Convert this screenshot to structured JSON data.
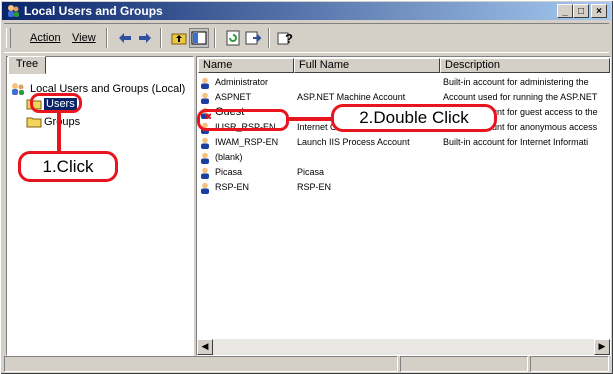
{
  "window": {
    "title": "Local Users and Groups",
    "controls": [
      "_",
      "□",
      "×"
    ]
  },
  "menu": {
    "action": "Action",
    "view": "View"
  },
  "tree": {
    "tab_label": "Tree",
    "root": "Local Users and Groups (Local)",
    "items": [
      "Users",
      "Groups"
    ]
  },
  "list": {
    "columns": [
      "Name",
      "Full Name",
      "Description"
    ],
    "rows": [
      {
        "name": "Administrator",
        "full_name": "",
        "description": "Built-in account for administering the"
      },
      {
        "name": "ASPNET",
        "full_name": "ASP.NET Machine Account",
        "description": "Account used for running the ASP.NET"
      },
      {
        "name": "Guest",
        "full_name": "",
        "description": "Built-in account for guest access to the"
      },
      {
        "name": "IUSR_RSP-EN",
        "full_name": "Internet Guest Account",
        "description": "Built-in account for anonymous access"
      },
      {
        "name": "IWAM_RSP-EN",
        "full_name": "Launch IIS Process Account",
        "description": "Built-in account for Internet Informati"
      },
      {
        "name": "(blank)",
        "full_name": "",
        "description": ""
      },
      {
        "name": "Picasa",
        "full_name": "Picasa",
        "description": ""
      },
      {
        "name": "RSP-EN",
        "full_name": "RSP-EN",
        "description": ""
      }
    ]
  },
  "callouts": {
    "step1": "1.Click",
    "step2": "2.Double Click"
  },
  "accent_color": "#e8141e",
  "titlebar_color": "#0a246a"
}
